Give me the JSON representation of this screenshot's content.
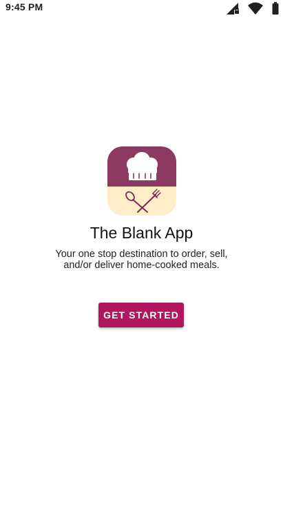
{
  "status_bar": {
    "time": "9:45 PM",
    "icons": [
      "signal-locked-icon",
      "wifi-icon",
      "battery-icon"
    ]
  },
  "app": {
    "logo": "chef-hat-spoon-fork-icon",
    "title": "The Blank App",
    "tagline_line1": "Your one stop destination to order, sell,",
    "tagline_line2": "and/or deliver home-cooked meals."
  },
  "actions": {
    "get_started_label": "GET STARTED"
  },
  "colors": {
    "brand_primary": "#b0175c",
    "logo_top": "#8c3a60",
    "logo_bottom": "#ffecc9"
  }
}
